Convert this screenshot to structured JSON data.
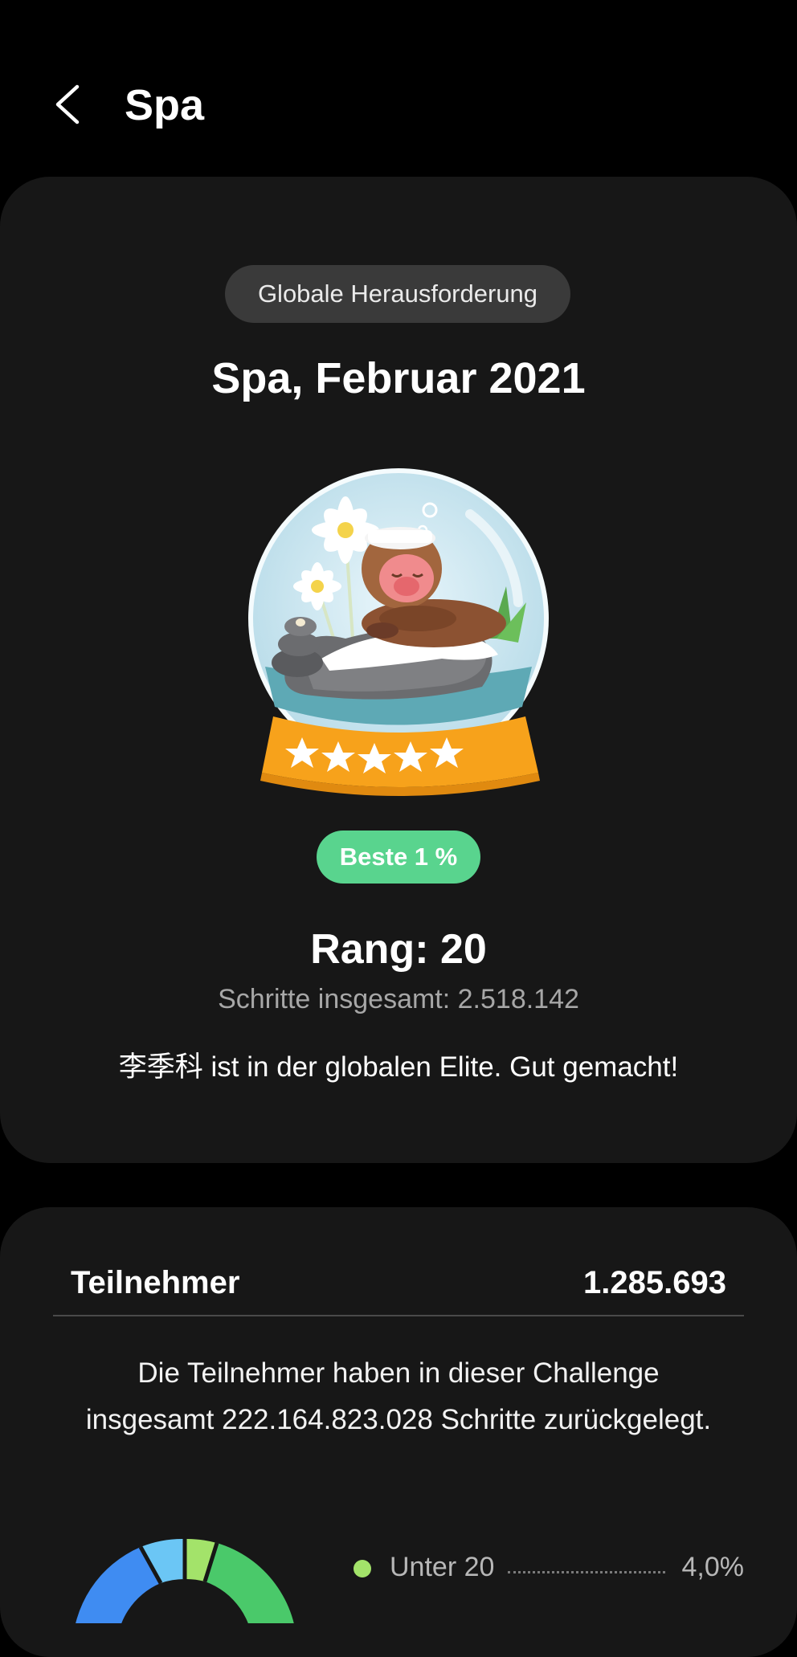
{
  "header": {
    "title": "Spa"
  },
  "challenge": {
    "badge": "Globale Herausforderung",
    "title": "Spa, Februar 2021",
    "best_badge": "Beste 1 %",
    "rank": "Rang: 20",
    "total_steps": "Schritte insgesamt: 2.518.142",
    "message": "李季科 ist in der globalen Elite. Gut gemacht!"
  },
  "participants": {
    "label": "Teilnehmer",
    "value": "1.285.693",
    "description": "Die Teilnehmer haben in dieser Challenge insgesamt 222.164.823.028 Schritte zurückgelegt.",
    "legend": [
      {
        "label": "Unter 20",
        "percent": "4,0%",
        "color": "#a3e36a"
      }
    ]
  },
  "colors": {
    "background": "#000000",
    "card": "#171717",
    "best_badge": "#59d48e",
    "globe_base": "#f7a21b"
  },
  "icons": [
    "back-arrow-icon",
    "snow-globe-trophy-icon",
    "star-icon"
  ]
}
